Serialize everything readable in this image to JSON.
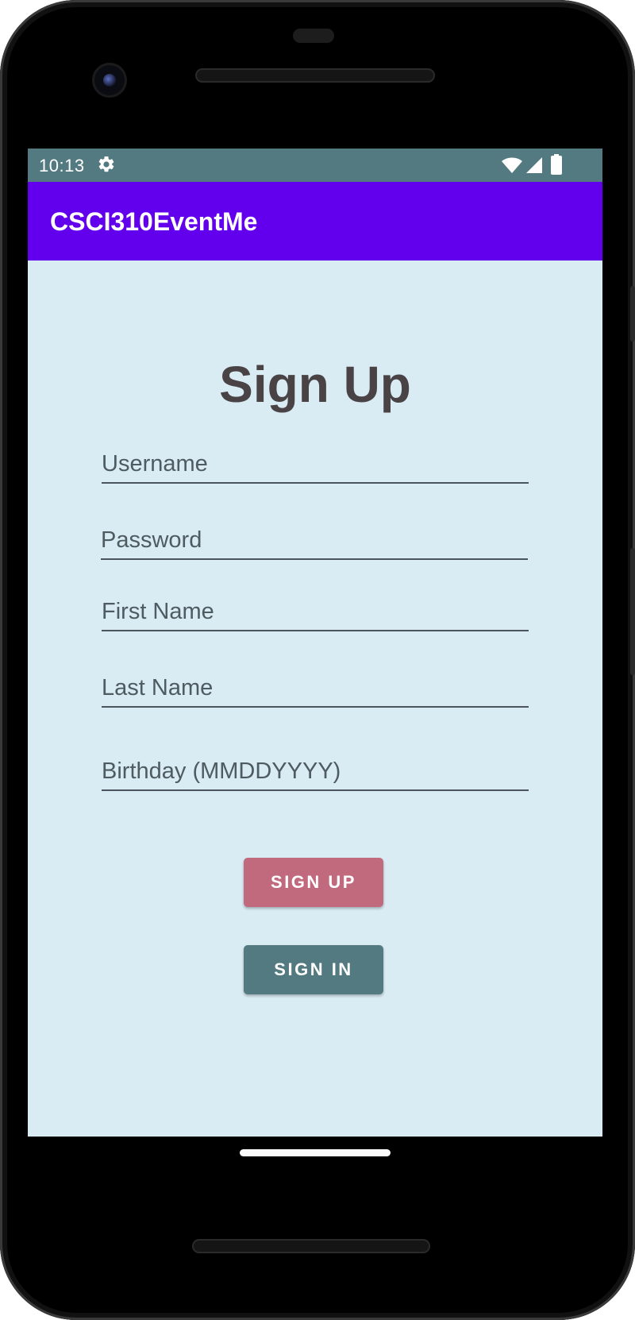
{
  "status_bar": {
    "time": "10:13",
    "icons": [
      "gear-icon",
      "wifi-icon",
      "cell-signal-icon",
      "battery-icon"
    ],
    "background_color": "#527a80"
  },
  "app_bar": {
    "title": "CSCI310EventMe",
    "background_color": "#6200ee"
  },
  "form": {
    "heading": "Sign Up",
    "fields": [
      {
        "name": "username",
        "placeholder": "Username",
        "value": ""
      },
      {
        "name": "password",
        "placeholder": "Password",
        "value": ""
      },
      {
        "name": "first_name",
        "placeholder": "First Name",
        "value": ""
      },
      {
        "name": "last_name",
        "placeholder": "Last Name",
        "value": ""
      },
      {
        "name": "birthday",
        "placeholder": "Birthday (MMDDYYYY)",
        "value": ""
      }
    ],
    "buttons": {
      "sign_up": {
        "label": "SIGN UP",
        "color": "#c26a7d"
      },
      "sign_in": {
        "label": "SIGN IN",
        "color": "#527a80"
      }
    }
  },
  "colors": {
    "screen_background": "#d9ecf3",
    "heading_text": "#4a4345"
  }
}
